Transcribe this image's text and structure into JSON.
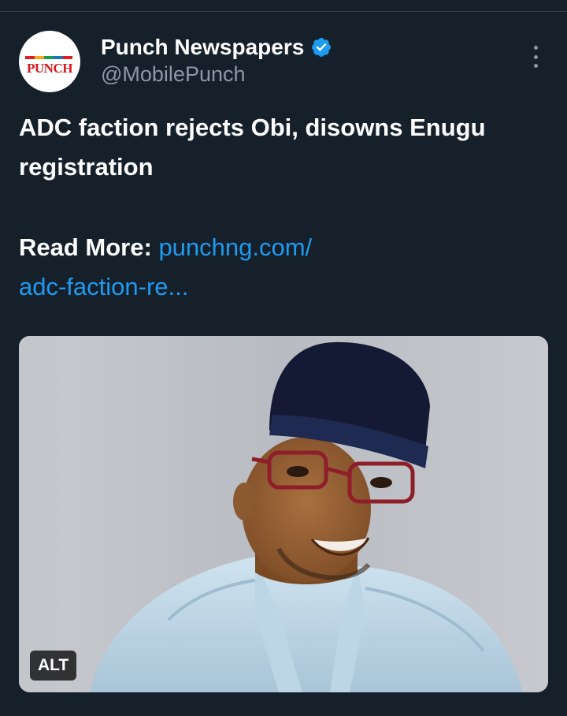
{
  "author": {
    "name": "Punch Newspapers",
    "handle": "@MobilePunch",
    "avatar_logo_text": "PUNCH",
    "verified_icon": "verified-badge-icon",
    "more_icon": "more-options-icon"
  },
  "post": {
    "headline": "ADC faction rejects Obi, disowns Enugu registration",
    "read_more_label": "Read More:",
    "link_line1": "punchng.com/",
    "link_line2": "adc-faction-re..."
  },
  "media": {
    "alt_badge": "ALT"
  },
  "colors": {
    "background": "#15202b",
    "text_primary": "#ffffff",
    "text_secondary": "#8b98a5",
    "link": "#1d9bf0",
    "verified": "#1d9bf0",
    "divider": "#38444d"
  }
}
